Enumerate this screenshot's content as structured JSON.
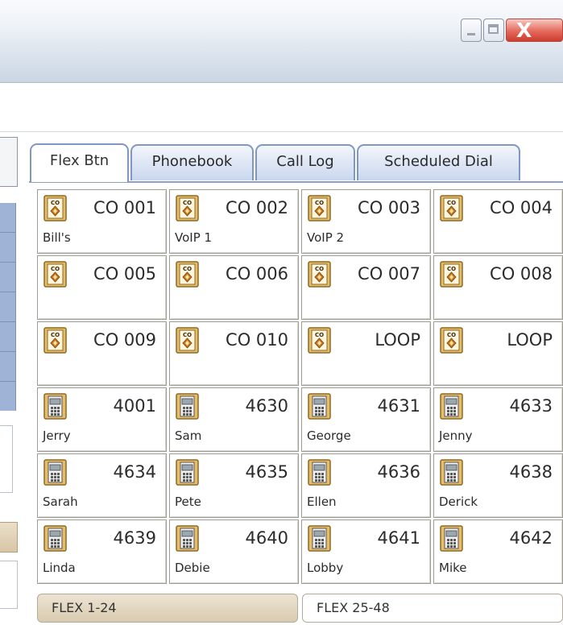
{
  "window": {
    "controls": [
      "minimize",
      "maximize",
      "close"
    ],
    "close_glyph": "X"
  },
  "tabs": [
    {
      "label": "Flex Btn",
      "active": true
    },
    {
      "label": "Phonebook",
      "active": false
    },
    {
      "label": "Call Log",
      "active": false
    },
    {
      "label": "Scheduled Dial",
      "active": false
    }
  ],
  "buttons": [
    {
      "icon": "co-line-icon",
      "number": "CO 001",
      "name": "Bill's"
    },
    {
      "icon": "co-line-icon",
      "number": "CO 002",
      "name": "VoIP 1"
    },
    {
      "icon": "co-line-icon",
      "number": "CO 003",
      "name": "VoIP 2"
    },
    {
      "icon": "co-line-icon",
      "number": "CO 004",
      "name": ""
    },
    {
      "icon": "co-line-icon",
      "number": "CO 005",
      "name": ""
    },
    {
      "icon": "co-line-icon",
      "number": "CO 006",
      "name": ""
    },
    {
      "icon": "co-line-icon",
      "number": "CO 007",
      "name": ""
    },
    {
      "icon": "co-line-icon",
      "number": "CO 008",
      "name": ""
    },
    {
      "icon": "co-line-icon",
      "number": "CO 009",
      "name": ""
    },
    {
      "icon": "co-line-icon",
      "number": "CO 010",
      "name": ""
    },
    {
      "icon": "co-line-icon",
      "number": "LOOP",
      "name": ""
    },
    {
      "icon": "co-line-icon",
      "number": "LOOP",
      "name": ""
    },
    {
      "icon": "extension-phone-icon",
      "number": "4001",
      "name": "Jerry"
    },
    {
      "icon": "extension-phone-icon",
      "number": "4630",
      "name": "Sam"
    },
    {
      "icon": "extension-phone-icon",
      "number": "4631",
      "name": "George"
    },
    {
      "icon": "extension-phone-icon",
      "number": "4633",
      "name": "Jenny"
    },
    {
      "icon": "extension-phone-icon",
      "number": "4634",
      "name": "Sarah"
    },
    {
      "icon": "extension-phone-icon",
      "number": "4635",
      "name": "Pete"
    },
    {
      "icon": "extension-phone-icon",
      "number": "4636",
      "name": "Ellen"
    },
    {
      "icon": "extension-phone-icon",
      "number": "4638",
      "name": "Derick"
    },
    {
      "icon": "extension-phone-icon",
      "number": "4639",
      "name": "Linda"
    },
    {
      "icon": "extension-phone-icon",
      "number": "4640",
      "name": "Debie"
    },
    {
      "icon": "extension-phone-icon",
      "number": "4641",
      "name": "Lobby"
    },
    {
      "icon": "extension-phone-icon",
      "number": "4642",
      "name": "Mike"
    }
  ],
  "pages": [
    {
      "label": "FLEX 1-24",
      "active": true
    },
    {
      "label": "FLEX 25-48",
      "active": false
    }
  ],
  "colors": {
    "tab_border": "#7f97c3",
    "icon_fill": "#e8bd6a",
    "icon_stroke": "#8a6a25",
    "active_page": "#d9cbb0"
  }
}
